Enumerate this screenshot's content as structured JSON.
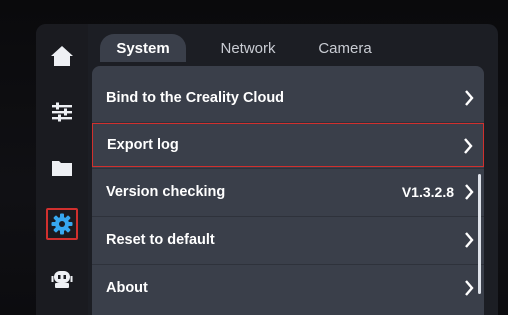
{
  "tabs": [
    {
      "label": "System",
      "active": true
    },
    {
      "label": "Network",
      "active": false
    },
    {
      "label": "Camera",
      "active": false
    }
  ],
  "sidebar": {
    "items": [
      {
        "icon": "home-icon"
      },
      {
        "icon": "sliders-icon"
      },
      {
        "icon": "folder-icon"
      },
      {
        "icon": "gear-icon",
        "active": true
      },
      {
        "icon": "robot-icon"
      }
    ]
  },
  "settings": {
    "rows": [
      {
        "label": "Bind to the Creality Cloud",
        "value": ""
      },
      {
        "label": "Export log",
        "value": "",
        "highlighted": true
      },
      {
        "label": "Version checking",
        "value": "V1.3.2.8"
      },
      {
        "label": "Reset to default",
        "value": ""
      },
      {
        "label": "About",
        "value": ""
      }
    ]
  },
  "colors": {
    "accent_red": "#d0302e",
    "panel": "#3a3f4a",
    "icon_blue": "#37a8f0"
  }
}
